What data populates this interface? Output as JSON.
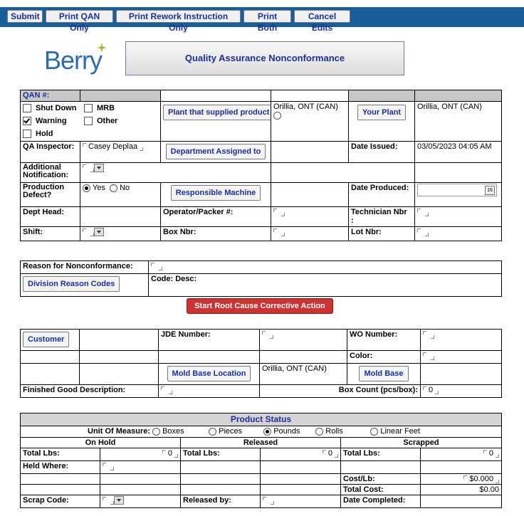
{
  "toolbar": {
    "submit": "Submit",
    "print_qan": "Print QAN Only",
    "print_rework": "Print Rework Instruction Only",
    "print_both": "Print Both",
    "cancel_edits": "Cancel Edits"
  },
  "header": {
    "logo_text": "Berry",
    "title": "Quality Assurance Nonconformance"
  },
  "qan": {
    "qan_label": "QAN #:",
    "shut_down": "Shut Down",
    "mrb": "MRB",
    "warning": "Warning",
    "other": "Other",
    "hold": "Hold",
    "warning_checked": true,
    "plant_supplied_btn": "Plant that supplied product",
    "plant_supplied_value": "Orillia, ONT (CAN)",
    "your_plant_btn": "Your Plant",
    "your_plant_value": "Orillia, ONT (CAN)",
    "qa_inspector_label": "QA Inspector:",
    "qa_inspector_value": "Casey Deplaa",
    "dept_assigned_btn": "Department Assigned to",
    "date_issued_label": "Date Issued:",
    "date_issued_value": "03/05/2023 04:05 AM",
    "additional_label_1": "Additional",
    "additional_label_2": "Notification:",
    "production_defect_1": "Production",
    "production_defect_2": "Defect?",
    "yes": "Yes",
    "no": "No",
    "responsible_machine_btn": "Responsible Machine",
    "date_produced_label": "Date Produced:",
    "calendar_day": "16",
    "dept_head_label": "Dept Head:",
    "operator_label": "Operator/Packer #:",
    "technician_label": "Technician Nbr",
    "technician_colon": ":",
    "shift_label": "Shift:",
    "box_nbr_label": "Box Nbr:",
    "lot_nbr_label": "Lot Nbr:"
  },
  "reason": {
    "label": "Reason for Nonconformance:",
    "division_btn": "Division Reason Codes",
    "code_desc": "Code:  Desc:",
    "rcca_btn": "Start Root Cause Corrective Action Form"
  },
  "customer": {
    "customer_btn": "Customer",
    "jde_label": "JDE Number:",
    "wo_label": "WO Number:",
    "color_label": "Color:",
    "mold_base_location_btn": "Mold Base Location",
    "mold_base_location_value": "Orillia, ONT (CAN)",
    "mold_base_btn": "Mold Base",
    "fg_desc_label": "Finished Good Description:",
    "box_count_label": "Box Count (pcs/box):",
    "box_count_value": "0"
  },
  "product_status": {
    "title": "Product Status",
    "uom_label": "Unit Of Measure:",
    "uom_options": [
      "Boxes",
      "Pieces",
      "Pounds",
      "Rolls",
      "Linear Feet"
    ],
    "uom_selected": "Pounds",
    "on_hold": "On Hold",
    "released": "Released",
    "scrapped": "Scrapped",
    "total_lbs": "Total Lbs:",
    "on_hold_total": "0",
    "released_total": "0",
    "scrapped_total": "0",
    "held_where": "Held Where:",
    "cost_lb_label": "Cost/Lb:",
    "cost_lb_value": "$0.000",
    "total_cost_label": "Total Cost:",
    "total_cost_value": "$0.00",
    "scrap_code_label": "Scrap Code:",
    "released_by_label": "Released by:",
    "date_completed_label": "Date Completed:"
  }
}
